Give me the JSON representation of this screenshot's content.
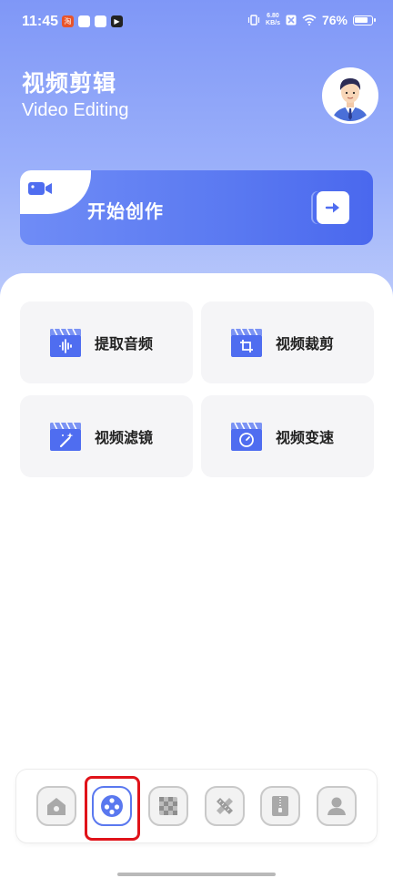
{
  "status_bar": {
    "time": "11:45",
    "net_speed_top": "6.80",
    "net_speed_bottom": "KB/s",
    "battery": "76%"
  },
  "header": {
    "title_cn": "视频剪辑",
    "title_en": "Video Editing"
  },
  "start_card": {
    "label": "开始创作"
  },
  "tools": [
    {
      "label": "提取音频",
      "icon": "audio-wave-icon"
    },
    {
      "label": "视频裁剪",
      "icon": "crop-icon"
    },
    {
      "label": "视频滤镜",
      "icon": "magic-wand-icon"
    },
    {
      "label": "视频变速",
      "icon": "speed-dial-icon"
    }
  ],
  "bottom_nav": [
    {
      "icon": "home-icon",
      "active": false
    },
    {
      "icon": "film-reel-icon",
      "active": true
    },
    {
      "icon": "mosaic-icon",
      "active": false
    },
    {
      "icon": "pencil-ruler-icon",
      "active": false
    },
    {
      "icon": "zip-archive-icon",
      "active": false
    },
    {
      "icon": "user-icon",
      "active": false
    }
  ],
  "colors": {
    "accent": "#5a78ef",
    "highlight": "#e0131a",
    "tile_bg": "#f5f5f7"
  }
}
